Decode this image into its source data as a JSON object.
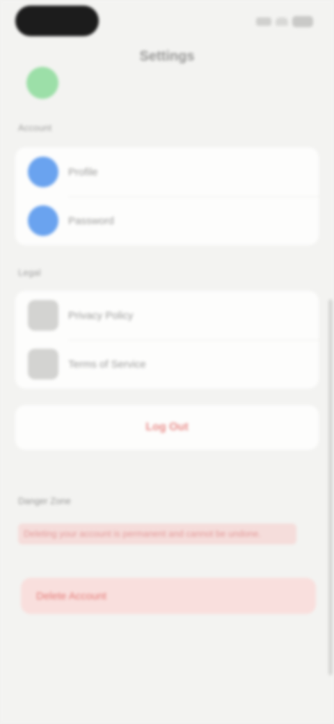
{
  "status_bar": {
    "icons": [
      "signal-icon",
      "wifi-icon",
      "battery-icon"
    ]
  },
  "header": {
    "title": "Settings"
  },
  "account": {
    "subtitle": ""
  },
  "sections": {
    "connected_label": "Account",
    "connected_items": [
      {
        "label": "Profile",
        "icon": "person-icon"
      },
      {
        "label": "Password",
        "icon": "key-icon"
      }
    ],
    "legal_label": "Legal",
    "legal_items": [
      {
        "label": "Privacy Policy",
        "icon": "document-icon"
      },
      {
        "label": "Terms of Service",
        "icon": "document-icon"
      }
    ]
  },
  "logout": {
    "label": "Log Out"
  },
  "danger_zone": {
    "label": "Danger Zone",
    "note": "Deleting your account is permanent and cannot be undone.",
    "delete_label": "Delete Account"
  },
  "colors": {
    "accent_blue": "#6aa3ef",
    "accent_green": "#7fd88f",
    "danger_red": "#e05a57",
    "danger_bg": "#f9dfdd",
    "background": "#f3f3f1"
  }
}
